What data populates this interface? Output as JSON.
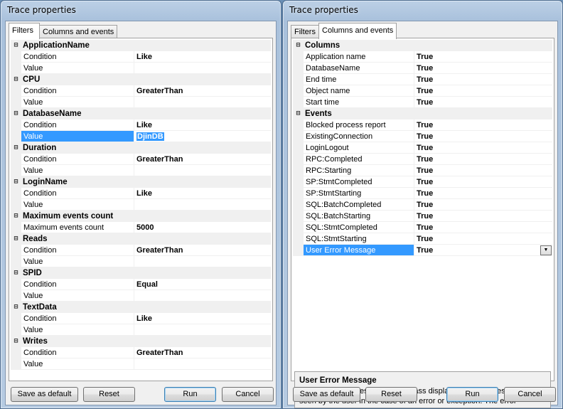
{
  "left_window": {
    "title": "Trace properties",
    "tabs": [
      "Filters",
      "Columns and events"
    ],
    "active_tab": "Filters",
    "categories": [
      {
        "name": "ApplicationName",
        "props": [
          {
            "name": "Condition",
            "value": "Like"
          },
          {
            "name": "Value",
            "value": ""
          }
        ]
      },
      {
        "name": "CPU",
        "props": [
          {
            "name": "Condition",
            "value": "GreaterThan"
          },
          {
            "name": "Value",
            "value": ""
          }
        ]
      },
      {
        "name": "DatabaseName",
        "props": [
          {
            "name": "Condition",
            "value": "Like"
          },
          {
            "name": "Value",
            "value": "DjinDB",
            "selected": true
          }
        ]
      },
      {
        "name": "Duration",
        "props": [
          {
            "name": "Condition",
            "value": "GreaterThan"
          },
          {
            "name": "Value",
            "value": ""
          }
        ]
      },
      {
        "name": "LoginName",
        "props": [
          {
            "name": "Condition",
            "value": "Like"
          },
          {
            "name": "Value",
            "value": ""
          }
        ]
      },
      {
        "name": "Maximum events count",
        "props": [
          {
            "name": "Maximum events count",
            "value": "5000"
          }
        ]
      },
      {
        "name": "Reads",
        "props": [
          {
            "name": "Condition",
            "value": "GreaterThan"
          },
          {
            "name": "Value",
            "value": ""
          }
        ]
      },
      {
        "name": "SPID",
        "props": [
          {
            "name": "Condition",
            "value": "Equal"
          },
          {
            "name": "Value",
            "value": ""
          }
        ]
      },
      {
        "name": "TextData",
        "props": [
          {
            "name": "Condition",
            "value": "Like"
          },
          {
            "name": "Value",
            "value": ""
          }
        ]
      },
      {
        "name": "Writes",
        "props": [
          {
            "name": "Condition",
            "value": "GreaterThan"
          },
          {
            "name": "Value",
            "value": ""
          }
        ]
      }
    ],
    "buttons": {
      "save_default": "Save as default",
      "reset": "Reset",
      "run": "Run",
      "cancel": "Cancel"
    }
  },
  "right_window": {
    "title": "Trace properties",
    "tabs": [
      "Filters",
      "Columns and events"
    ],
    "active_tab": "Columns and events",
    "categories": [
      {
        "name": "Columns",
        "props": [
          {
            "name": "Application name",
            "value": "True"
          },
          {
            "name": "DatabaseName",
            "value": "True"
          },
          {
            "name": "End time",
            "value": "True"
          },
          {
            "name": "Object name",
            "value": "True"
          },
          {
            "name": "Start time",
            "value": "True"
          }
        ]
      },
      {
        "name": "Events",
        "props": [
          {
            "name": "Blocked process report",
            "value": "True"
          },
          {
            "name": "ExistingConnection",
            "value": "True"
          },
          {
            "name": "LoginLogout",
            "value": "True"
          },
          {
            "name": "RPC:Completed",
            "value": "True"
          },
          {
            "name": "RPC:Starting",
            "value": "True"
          },
          {
            "name": "SP:StmtCompleted",
            "value": "True"
          },
          {
            "name": "SP:StmtStarting",
            "value": "True"
          },
          {
            "name": "SQL:BatchCompleted",
            "value": "True"
          },
          {
            "name": "SQL:BatchStarting",
            "value": "True"
          },
          {
            "name": "SQL:StmtCompleted",
            "value": "True"
          },
          {
            "name": "SQL:StmtStarting",
            "value": "True"
          },
          {
            "name": "User Error Message",
            "value": "True",
            "selected": true,
            "dropdown": true
          }
        ]
      }
    ],
    "description": {
      "title": "User Error Message",
      "text": "The User Error Message event class displays the error message as seen by the user in the case of an error or exception. The error message text app..."
    },
    "buttons": {
      "save_default": "Save as default",
      "reset": "Reset",
      "run": "Run",
      "cancel": "Cancel"
    }
  },
  "icons": {
    "expanded": "collapse-minus-icon",
    "dropdown": "chevron-down-icon"
  },
  "colors": {
    "selection": "#3399ff",
    "category_bg": "#f0f0f0"
  }
}
